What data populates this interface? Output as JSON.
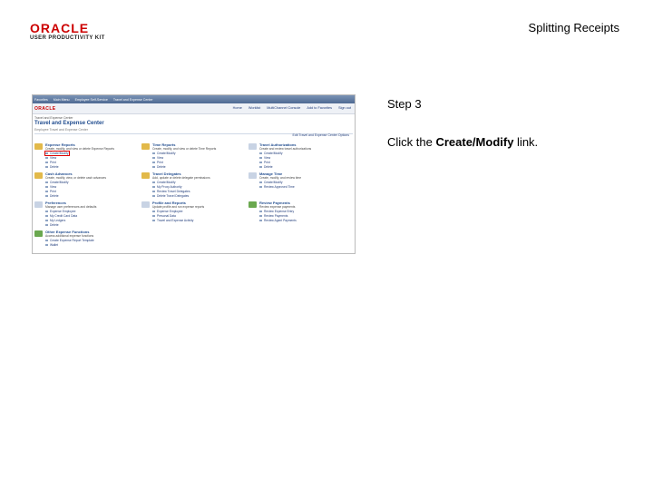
{
  "header": {
    "logo_line1": "ORACLE",
    "logo_line2": "USER PRODUCTIVITY KIT",
    "doc_title": "Splitting Receipts"
  },
  "step": {
    "label": "Step 3",
    "instruction_prefix": "Click the ",
    "instruction_target": "Create/Modify",
    "instruction_suffix": " link."
  },
  "screenshot": {
    "topnav": [
      "Favorites",
      "Main Menu",
      "Employee Self-Service",
      "Travel and Expense Center"
    ],
    "brand": "ORACLE",
    "menu_links": [
      "Home",
      "Worklist",
      "MultiChannel Console",
      "Add to Favorites",
      "Sign out"
    ],
    "breadcrumb": "Travel and Expense Center",
    "page_title": "Travel and Expense Center",
    "subtitle": "Employee Travel and Expense Center",
    "topright_link": "Edit Travel and Expense Center Options",
    "sections": [
      {
        "title": "Expense Reports",
        "desc": "Create, modify, and view or delete Expense Reports",
        "links": [
          "Create/Modify",
          "View",
          "Print",
          "Delete"
        ]
      },
      {
        "title": "Time Reports",
        "desc": "Create, modify, and view or delete Time Reports",
        "links": [
          "Create/Modify",
          "View",
          "Print",
          "Delete"
        ]
      },
      {
        "title": "Travel Authorizations",
        "desc": "Create and review travel authorizations",
        "links": [
          "Create/Modify",
          "View",
          "Print",
          "Delete"
        ]
      },
      {
        "title": "Cash Advances",
        "desc": "Create, modify, view, or delete cash advances",
        "links": [
          "Create/Modify",
          "View",
          "Print",
          "Delete"
        ]
      },
      {
        "title": "Travel Delegates",
        "desc": "Add, update or delete delegate permissions",
        "links": [
          "Create/Modify",
          "My Proxy Authority",
          "Review Travel Delegates",
          "Delete Travel Delegates"
        ]
      },
      {
        "title": "Manage Time",
        "desc": "Create, modify, and review time",
        "links": [
          "Create/Modify",
          "Review Approved Time"
        ]
      },
      {
        "title": "Preferences",
        "desc": "Manage user preferences and defaults",
        "links": [
          "Expense Employee",
          "My Credit Card Data",
          "My Ledgers",
          "Delete"
        ]
      },
      {
        "title": "Profile and Reports",
        "desc": "Update profile and run expense reports",
        "links": [
          "Expense Employee",
          "Personal Data",
          "Travel and Expense Activity"
        ]
      },
      {
        "title": "Review Payments",
        "desc": "Review expense payments",
        "links": [
          "Review Expense Entry",
          "Review Payments",
          "Review Agent Payments"
        ]
      },
      {
        "title": "Other Expense Functions",
        "desc": "Access additional expense functions",
        "links": [
          "Create Expense Report Template",
          "Wallet"
        ]
      }
    ]
  }
}
